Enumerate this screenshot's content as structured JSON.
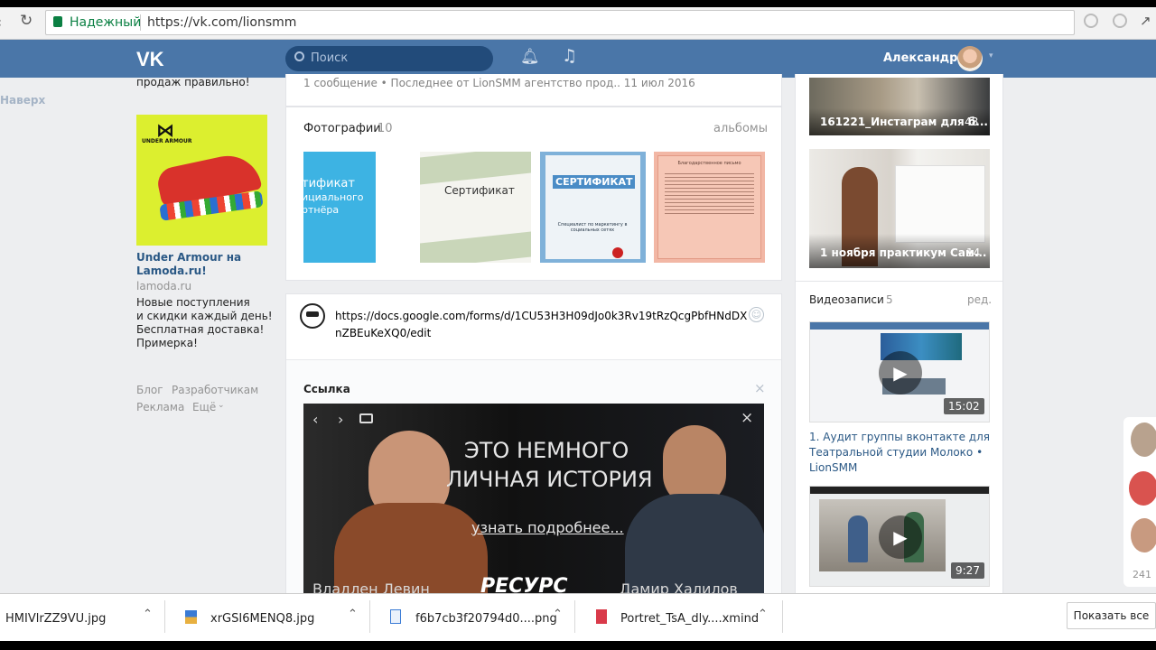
{
  "browser": {
    "secure_label": "Надежный",
    "url": "https://vk.com/lionsmm"
  },
  "header": {
    "search_placeholder": "Поиск",
    "user_name": "Александра"
  },
  "left": {
    "back_to_top": "Наверх",
    "prev_text": "продаж правильно!",
    "ad": {
      "brand": "UNDER ARMOUR",
      "title": "Under Armour на Lamoda.ru!",
      "domain": "lamoda.ru",
      "lines": [
        "Новые поступления",
        "и скидки каждый день!",
        "Бесплатная доставка!",
        "Примерка!"
      ]
    },
    "footer": {
      "blog": "Блог",
      "devs": "Разработчикам",
      "ads": "Реклама",
      "more": "Ещё"
    }
  },
  "main": {
    "discussion_meta": "1 сообщение  •  Последнее от LionSMM агентство прод.. 11 июл 2016",
    "photos": {
      "title": "Фотографии",
      "count": "10",
      "albums": "альбомы",
      "items": [
        {
          "line1": "тификат",
          "line2": "ициального",
          "line3": "ртнёра"
        },
        {
          "line1": "Сертификат"
        },
        {
          "line1": "СЕРТИФИКАТ",
          "line2": "Специалист по маркетингу в социальных сетях"
        },
        {
          "line1": "Благодарственное письмо"
        }
      ]
    },
    "post": {
      "text": "https://docs.google.com/forms/d/1CU53H3H09dJo0k3Rv19tRzQcgPbfHNdDXnZBEuKeXQ0/edit",
      "link_label": "Ссылка",
      "banner": {
        "line1": "ЭТО НЕМНОГО",
        "line2": "ЛИЧНАЯ ИСТОРИЯ",
        "cta": "узнать подробнее...",
        "left_name": "Владлен Левин",
        "right_name": "Дамир Халилов",
        "logo": "РЕСУРС"
      }
    }
  },
  "right": {
    "albums": [
      {
        "title": "161221_Инстаграм для б...",
        "count": "48"
      },
      {
        "title": "1 ноября практикум Сам...",
        "count": "14"
      }
    ],
    "videos": {
      "title": "Видеозаписи",
      "count": "5",
      "edit": "ред.",
      "items": [
        {
          "duration": "15:02",
          "title": "1. Аудит группы вконтакте для Театральной студии Молоко • LionSMM"
        },
        {
          "duration": "9:27"
        }
      ]
    },
    "online_count": "241"
  },
  "downloads": {
    "items": [
      "HMIVlrZZ9VU.jpg",
      "xrGSI6MENQ8.jpg",
      "f6b7cb3f20794d0....png",
      "Portret_TsA_dly....xmind"
    ],
    "show_all": "Показать все"
  },
  "colors": {
    "vk_blue": "#4a76a8",
    "link": "#2a5885",
    "muted": "#939393"
  }
}
